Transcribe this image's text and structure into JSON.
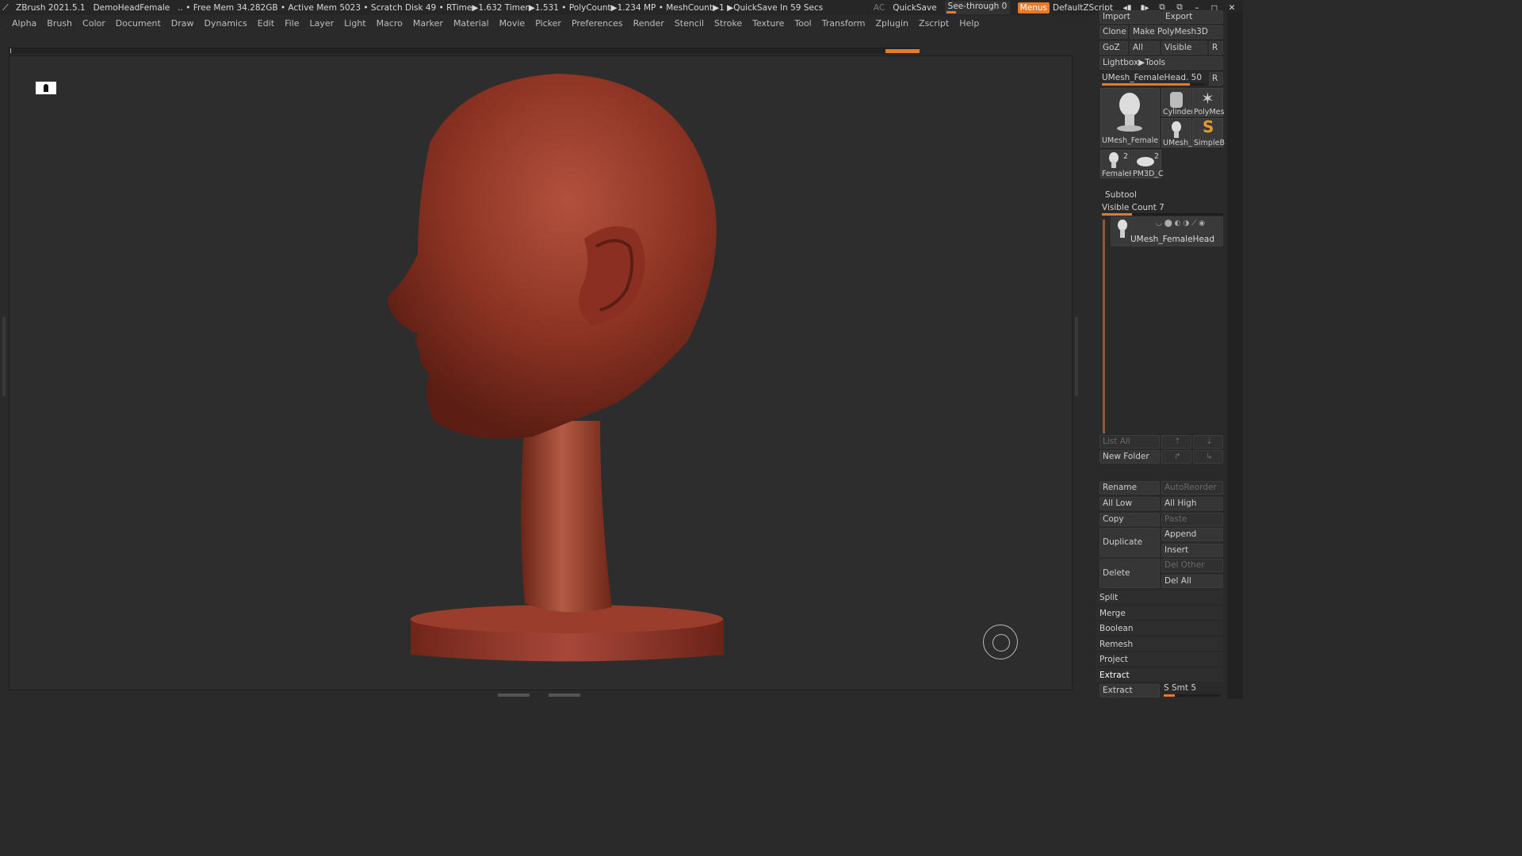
{
  "titlebar": {
    "app": "ZBrush 2021.5.1",
    "document": "DemoHeadFemale",
    "status": ".. • Free Mem 34.282GB • Active Mem 5023 • Scratch Disk 49 •  RTime▶1.632 Timer▶1.531 • PolyCount▶1.234 MP  • MeshCount▶1  ▶QuickSave In 59 Secs",
    "ac": "AC",
    "quicksave": "QuickSave",
    "seethrough": "See-through  0",
    "menus": "Menus",
    "script": "DefaultZScript"
  },
  "menubar": [
    "Alpha",
    "Brush",
    "Color",
    "Document",
    "Draw",
    "Dynamics",
    "Edit",
    "File",
    "Layer",
    "Light",
    "Macro",
    "Marker",
    "Material",
    "Movie",
    "Picker",
    "Preferences",
    "Render",
    "Stencil",
    "Stroke",
    "Texture",
    "Tool",
    "Transform",
    "Zplugin",
    "Zscript",
    "Help"
  ],
  "tool_palette": {
    "import": "Import",
    "export": "Export",
    "clone": "Clone",
    "make_polymesh": "Make PolyMesh3D",
    "goz": "GoZ",
    "all": "All",
    "visible": "Visible",
    "r": "R",
    "lightbox_tools": "Lightbox▶Tools",
    "current_tool": "UMesh_FemaleHead. 50",
    "current_tool_slider": 0.85,
    "thumbs": {
      "main": "UMesh_FemaleH",
      "cylinder": "Cylinder",
      "polymesh": "PolyMes",
      "umesh_small": "UMesh_",
      "simpleb": "SimpleB",
      "female": "FemaleH",
      "female_count": "2",
      "pm3d": "PM3D_C",
      "pm3d_count": "2"
    }
  },
  "subtool": {
    "title": "Subtool",
    "visible_count": "Visible Count 7",
    "visible_count_slider": 0.25,
    "item_name": "UMesh_FemaleHead",
    "list_all": "List All",
    "new_folder": "New Folder",
    "rename": "Rename",
    "autoreorder": "AutoReorder",
    "all_low": "All Low",
    "all_high": "All High",
    "copy": "Copy",
    "paste": "Paste",
    "duplicate": "Duplicate",
    "append": "Append",
    "insert": "Insert",
    "delete": "Delete",
    "del_other": "Del Other",
    "del_all": "Del All",
    "split": "Split",
    "merge": "Merge",
    "boolean": "Boolean",
    "remesh": "Remesh",
    "project": "Project",
    "extract": "Extract",
    "extract_btn": "Extract",
    "s_smt": "S Smt 5",
    "s_smt_slider": 0.2
  },
  "colors": {
    "accent": "#e57a2a",
    "clay": "#8e3424"
  }
}
